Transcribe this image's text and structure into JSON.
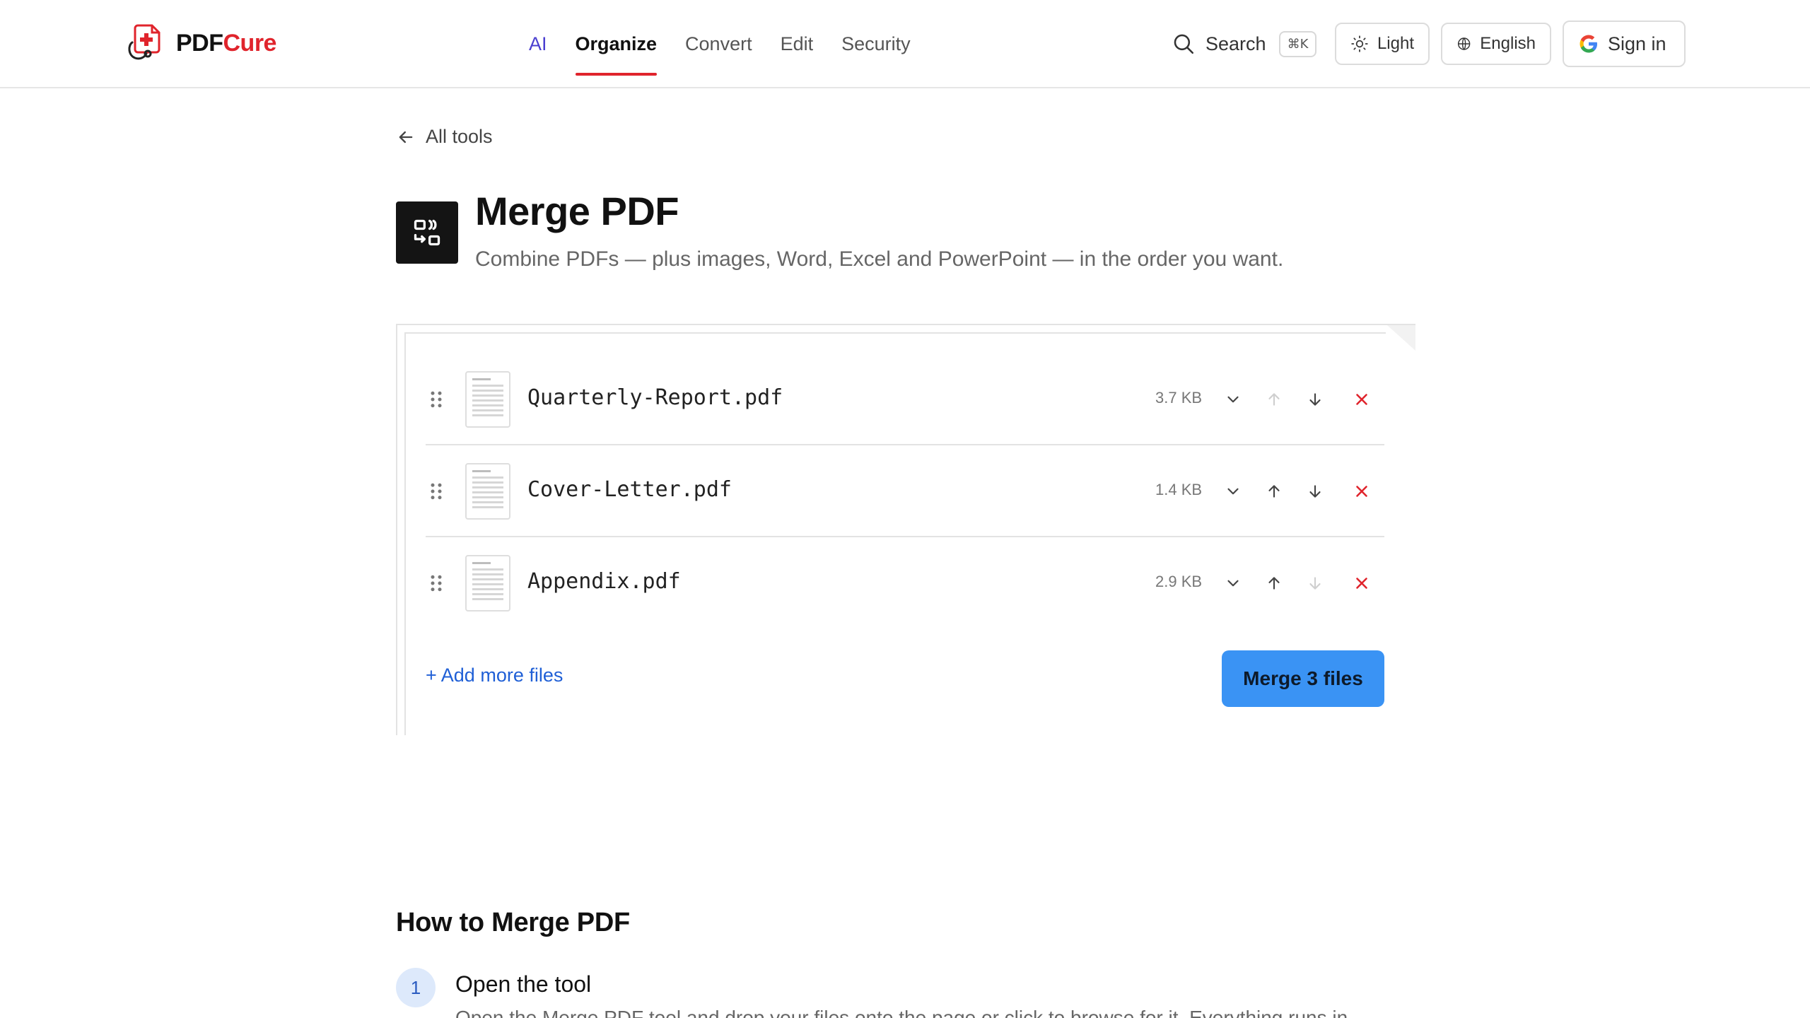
{
  "brand": {
    "name_a": "PDF",
    "name_b": "Cure",
    "accent": "#e0242c"
  },
  "nav": [
    {
      "label": "AI"
    },
    {
      "label": "Organize"
    },
    {
      "label": "Convert"
    },
    {
      "label": "Edit"
    },
    {
      "label": "Security"
    }
  ],
  "header": {
    "search_label": "Search",
    "search_shortcut": "⌘K",
    "theme_label": "Light",
    "language_label": "English",
    "signin_label": "Sign in"
  },
  "back_label": "All tools",
  "tool": {
    "title": "Merge PDF",
    "subtitle": "Combine PDFs — plus images, Word, Excel and PowerPoint — in the order you want."
  },
  "files": [
    {
      "name": "Quarterly-Report.pdf",
      "size": "3.7 KB",
      "can_move_up": false,
      "can_move_down": true
    },
    {
      "name": "Cover-Letter.pdf",
      "size": "1.4 KB",
      "can_move_up": true,
      "can_move_down": true
    },
    {
      "name": "Appendix.pdf",
      "size": "2.9 KB",
      "can_move_up": true,
      "can_move_down": false
    }
  ],
  "actions": {
    "add_more": "+ Add more files",
    "merge": "Merge 3 files",
    "merge_color": "#3a93f4"
  },
  "how_to": {
    "title": "How to Merge PDF",
    "steps": [
      {
        "number": "1",
        "title": "Open the tool",
        "desc": "Open the Merge PDF tool and drop your files onto the page or click to browse for it. Everything runs in"
      }
    ]
  }
}
